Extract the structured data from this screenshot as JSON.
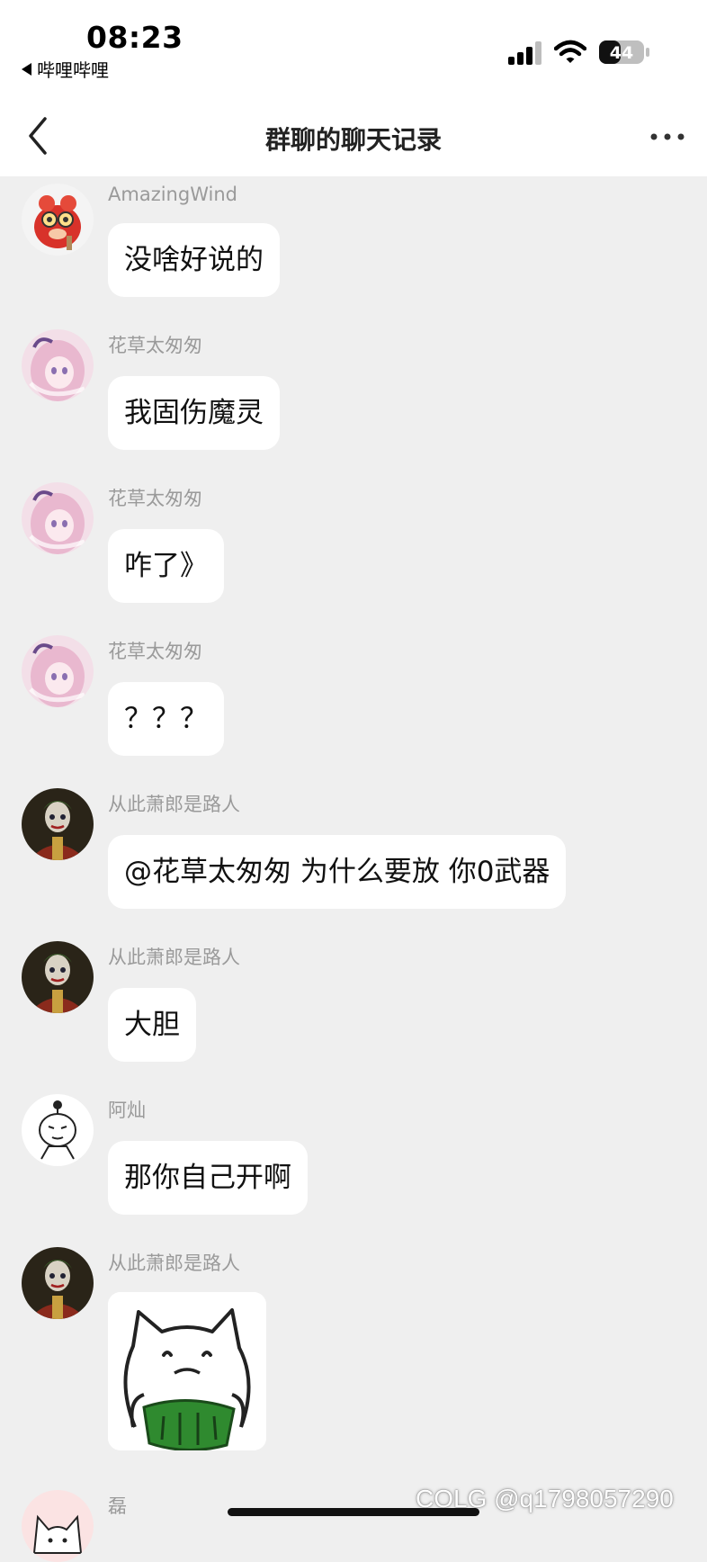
{
  "status": {
    "time": "08:23",
    "back_app": "哔哩哔哩",
    "battery": "44"
  },
  "header": {
    "title": "群聊的聊天记录"
  },
  "messages": [
    {
      "sender": "AmazingWind",
      "text": "没啥好说的",
      "avatar": "red-creature-avatar"
    },
    {
      "sender": "花草太匆匆",
      "text": "我固伤魔灵",
      "avatar": "pink-hair-girl-avatar"
    },
    {
      "sender": "花草太匆匆",
      "text": "咋了》",
      "avatar": "pink-hair-girl-avatar"
    },
    {
      "sender": "花草太匆匆",
      "text": "？？？",
      "avatar": "pink-hair-girl-avatar"
    },
    {
      "sender": "从此萧郎是路人",
      "text": "@花草太匆匆 为什么要放 你0武器",
      "avatar": "joker-avatar"
    },
    {
      "sender": "从此萧郎是路人",
      "text": "大胆",
      "avatar": "joker-avatar"
    },
    {
      "sender": "阿灿",
      "text": "那你自己开啊",
      "avatar": "sketch-girl-avatar"
    },
    {
      "sender": "从此萧郎是路人",
      "sticker": "cat-eating-watermelon-sticker",
      "avatar": "joker-avatar"
    },
    {
      "sender": "磊",
      "avatar": "white-cat-avatar"
    }
  ],
  "watermark": "COLG @q1798057290",
  "colors": {
    "background": "#efefef",
    "bubble": "#ffffff",
    "sender_name": "#9a9a9a",
    "bar": "#ffffff"
  }
}
